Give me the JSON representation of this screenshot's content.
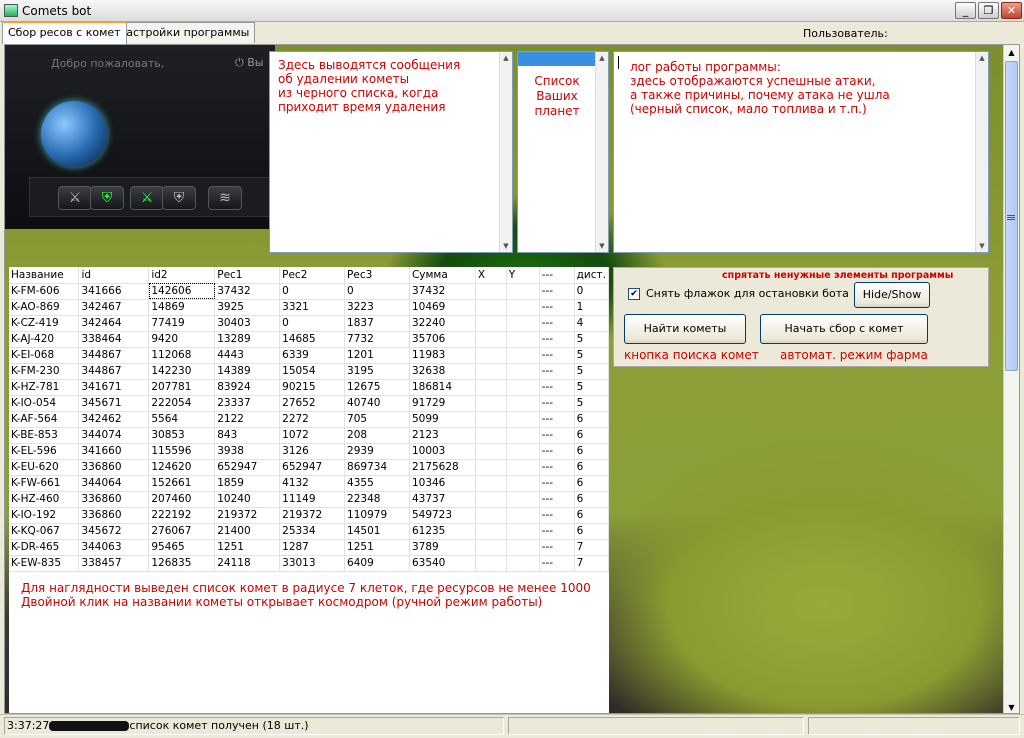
{
  "window": {
    "title": "Comets bot",
    "buttons": [
      "_",
      "❐",
      "✕"
    ]
  },
  "tabs": [
    {
      "label": "Сбор ресов с комет",
      "active": true
    },
    {
      "label": "Настройки программы",
      "active": false
    }
  ],
  "user_label": "Пользователь:",
  "game": {
    "welcome": "Добро пожаловать,",
    "exit": "⏻ Вы"
  },
  "messages": {
    "deletion_text": "Здесь выводятся сообщения\nоб удалении кометы\nиз черного списка, когда\nприходит время удаления",
    "planets_text": "Список\nВаших\nпланет",
    "log_text": "лог работы программы:\nздесь отображаются успешные атаки,\nа также причины, почему атака не ушла\n(черный список, мало топлива и т.п.)"
  },
  "table": {
    "headers": [
      "Название",
      "id",
      "id2",
      "Рес1",
      "Рес2",
      "Рес3",
      "Сумма",
      "X",
      "Y",
      "---",
      "дист."
    ],
    "rows": [
      [
        "K-FM-606",
        "341666",
        "142606",
        "37432",
        "0",
        "0",
        "37432",
        "",
        "",
        "---",
        "0"
      ],
      [
        "K-AO-869",
        "342467",
        "14869",
        "3925",
        "3321",
        "3223",
        "10469",
        "",
        "",
        "---",
        "1"
      ],
      [
        "K-CZ-419",
        "342464",
        "77419",
        "30403",
        "0",
        "1837",
        "32240",
        "",
        "",
        "---",
        "4"
      ],
      [
        "K-AJ-420",
        "338464",
        "9420",
        "13289",
        "14685",
        "7732",
        "35706",
        "",
        "",
        "---",
        "5"
      ],
      [
        "K-EI-068",
        "344867",
        "112068",
        "4443",
        "6339",
        "1201",
        "11983",
        "",
        "",
        "---",
        "5"
      ],
      [
        "K-FM-230",
        "344867",
        "142230",
        "14389",
        "15054",
        "3195",
        "32638",
        "",
        "",
        "---",
        "5"
      ],
      [
        "K-HZ-781",
        "341671",
        "207781",
        "83924",
        "90215",
        "12675",
        "186814",
        "",
        "",
        "---",
        "5"
      ],
      [
        "K-IO-054",
        "345671",
        "222054",
        "23337",
        "27652",
        "40740",
        "91729",
        "",
        "",
        "---",
        "5"
      ],
      [
        "K-AF-564",
        "342462",
        "5564",
        "2122",
        "2272",
        "705",
        "5099",
        "",
        "",
        "---",
        "6"
      ],
      [
        "K-BE-853",
        "344074",
        "30853",
        "843",
        "1072",
        "208",
        "2123",
        "",
        "",
        "---",
        "6"
      ],
      [
        "K-EL-596",
        "341660",
        "115596",
        "3938",
        "3126",
        "2939",
        "10003",
        "",
        "",
        "---",
        "6"
      ],
      [
        "K-EU-620",
        "336860",
        "124620",
        "652947",
        "652947",
        "869734",
        "2175628",
        "",
        "",
        "---",
        "6"
      ],
      [
        "K-FW-661",
        "344064",
        "152661",
        "1859",
        "4132",
        "4355",
        "10346",
        "",
        "",
        "---",
        "6"
      ],
      [
        "K-HZ-460",
        "336860",
        "207460",
        "10240",
        "11149",
        "22348",
        "43737",
        "",
        "",
        "---",
        "6"
      ],
      [
        "K-IO-192",
        "336860",
        "222192",
        "219372",
        "219372",
        "110979",
        "549723",
        "",
        "",
        "---",
        "6"
      ],
      [
        "K-KQ-067",
        "345672",
        "276067",
        "21400",
        "25334",
        "14501",
        "61235",
        "",
        "",
        "---",
        "6"
      ],
      [
        "K-DR-465",
        "344063",
        "95465",
        "1251",
        "1287",
        "1251",
        "3789",
        "",
        "",
        "---",
        "7"
      ],
      [
        "K-EW-835",
        "338457",
        "126835",
        "24118",
        "33013",
        "6409",
        "63540",
        "",
        "",
        "---",
        "7"
      ]
    ]
  },
  "note": {
    "line1": "Для наглядности выведен список комет в радиусе 7 клеток, где ресурсов не менее 1000",
    "line2": "Двойной клик на названии кометы открывает космодром (ручной режим работы)"
  },
  "controls": {
    "hide_caption": "спрятать ненужные элементы программы",
    "checkbox_label": "Снять флажок для остановки бота",
    "checkbox_checked": "✔",
    "hide_show": "Hide/Show",
    "find_comets": "Найти кометы",
    "start_collect": "Начать сбор с комет",
    "find_caption": "кнопка поиска комет",
    "auto_caption": "автомат. режим фарма"
  },
  "status": {
    "time": "3:37:27",
    "message": "список комет получен (18 шт.)"
  },
  "colors": {
    "note_red": "#d00000",
    "tab_highlight": "#ff9c2a",
    "selection": "#3a8fe0"
  }
}
